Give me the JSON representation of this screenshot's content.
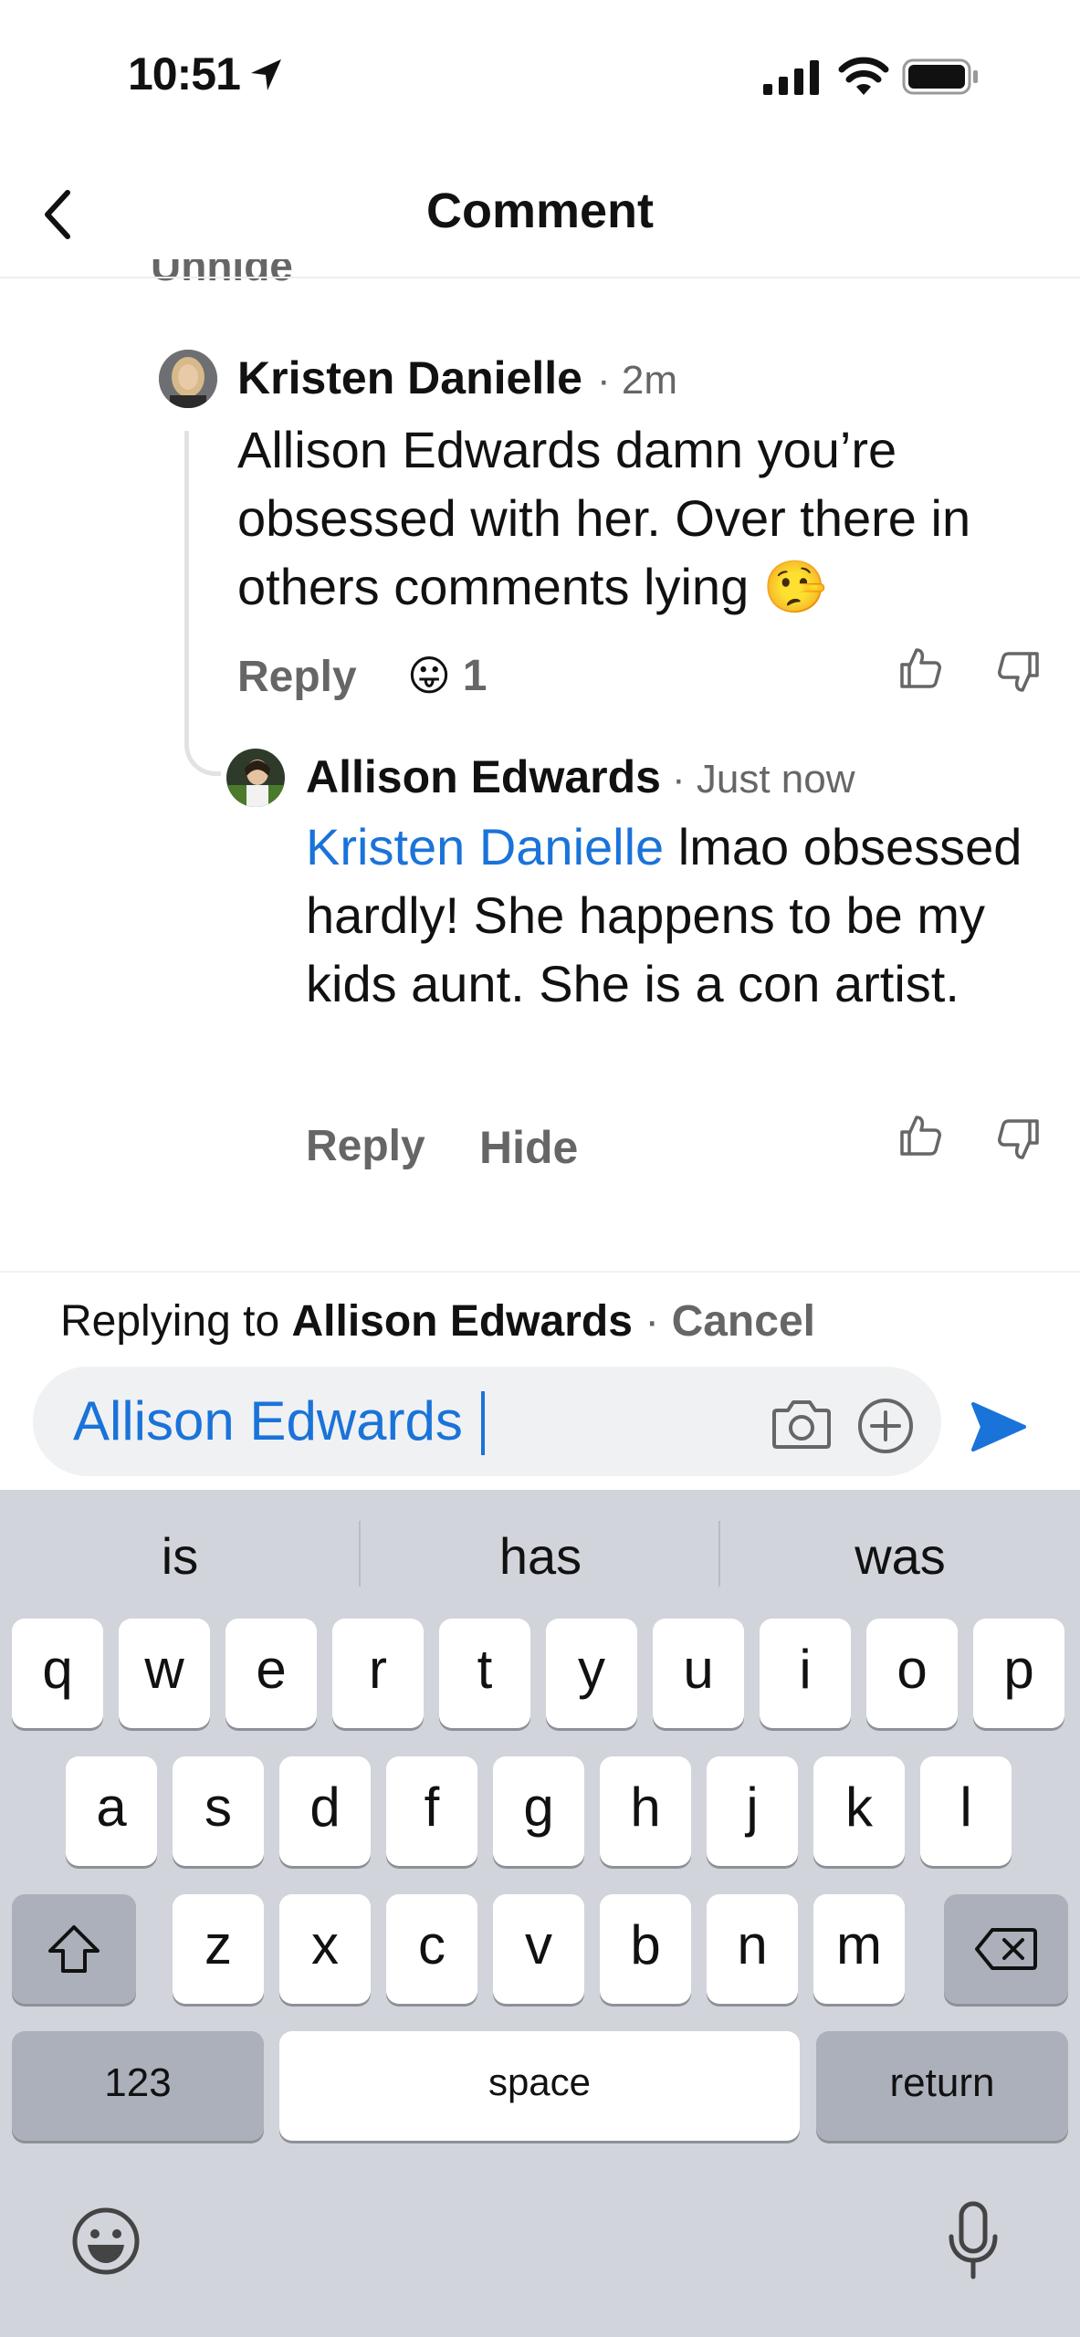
{
  "status_bar": {
    "time": "10:51"
  },
  "header": {
    "title": "Comment"
  },
  "clipped_text": "Unhide",
  "comments": [
    {
      "author": "Kristen Danielle",
      "meta": "· 2m",
      "body": "Allison Edwards damn you’re obsessed with her. Over there in others comments lying 🤥",
      "reply_label": "Reply",
      "reaction_emoji": "😛",
      "reaction_count": "1"
    },
    {
      "author": "Allison Edwards",
      "meta": "· Just now",
      "mention": "Kristen Danielle",
      "body": "lmao obsessed hardly! She happens to be my kids aunt. She is a con artist.",
      "reply_label": "Reply",
      "hide_label": "Hide"
    }
  ],
  "reply_bar": {
    "prefix": "Replying to",
    "name": "Allison Edwards",
    "separator": "·",
    "cancel": "Cancel",
    "input_value": "Allison Edwards"
  },
  "keyboard": {
    "suggestions": [
      "is",
      "has",
      "was"
    ],
    "row1": [
      "q",
      "w",
      "e",
      "r",
      "t",
      "y",
      "u",
      "i",
      "o",
      "p"
    ],
    "row2": [
      "a",
      "s",
      "d",
      "f",
      "g",
      "h",
      "j",
      "k",
      "l"
    ],
    "row3": [
      "z",
      "x",
      "c",
      "v",
      "b",
      "n",
      "m"
    ],
    "numbers_label": "123",
    "space_label": "space",
    "return_label": "return"
  },
  "colors": {
    "link": "#1a73d9",
    "muted": "#666666",
    "keyboard_bg": "#d1d4da"
  },
  "icons": [
    "location-arrow-icon",
    "signal-icon",
    "wifi-icon",
    "battery-icon",
    "back-chevron-icon",
    "thumbs-up-icon",
    "thumbs-down-icon",
    "camera-icon",
    "add-circle-icon",
    "send-icon",
    "shift-icon",
    "delete-icon",
    "emoji-icon",
    "microphone-icon"
  ]
}
